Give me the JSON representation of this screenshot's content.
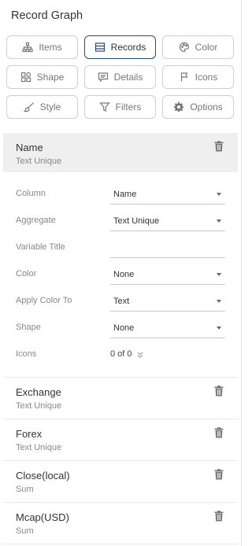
{
  "panel": {
    "title": "Record Graph"
  },
  "tabs": [
    {
      "label": "Items",
      "icon": "hierarchy-icon"
    },
    {
      "label": "Records",
      "icon": "table-rows-icon",
      "active": true
    },
    {
      "label": "Color",
      "icon": "palette-icon"
    },
    {
      "label": "Shape",
      "icon": "shapes-icon"
    },
    {
      "label": "Details",
      "icon": "comment-icon"
    },
    {
      "label": "Icons",
      "icon": "flag-icon"
    },
    {
      "label": "Style",
      "icon": "brush-icon"
    },
    {
      "label": "Filters",
      "icon": "funnel-icon"
    },
    {
      "label": "Options",
      "icon": "gear-icon"
    }
  ],
  "records": [
    {
      "name": "Name",
      "aggregate": "Text Unique",
      "selected": true
    },
    {
      "name": "Exchange",
      "aggregate": "Text Unique"
    },
    {
      "name": "Forex",
      "aggregate": "Text Unique"
    },
    {
      "name": "Close(local)",
      "aggregate": "Sum"
    },
    {
      "name": "Mcap(USD)",
      "aggregate": "Sum"
    }
  ],
  "settings": {
    "column": {
      "label": "Column",
      "value": "Name"
    },
    "aggregate": {
      "label": "Aggregate",
      "value": "Text Unique"
    },
    "variable_title": {
      "label": "Variable Title",
      "value": ""
    },
    "color": {
      "label": "Color",
      "value": "None"
    },
    "apply_color_to": {
      "label": "Apply Color To",
      "value": "Text"
    },
    "shape": {
      "label": "Shape",
      "value": "None"
    },
    "icons": {
      "label": "Icons",
      "value": "0 of 0"
    }
  },
  "colors": {
    "active_border": "#2c4a6e",
    "selected_bg": "#efefef"
  }
}
